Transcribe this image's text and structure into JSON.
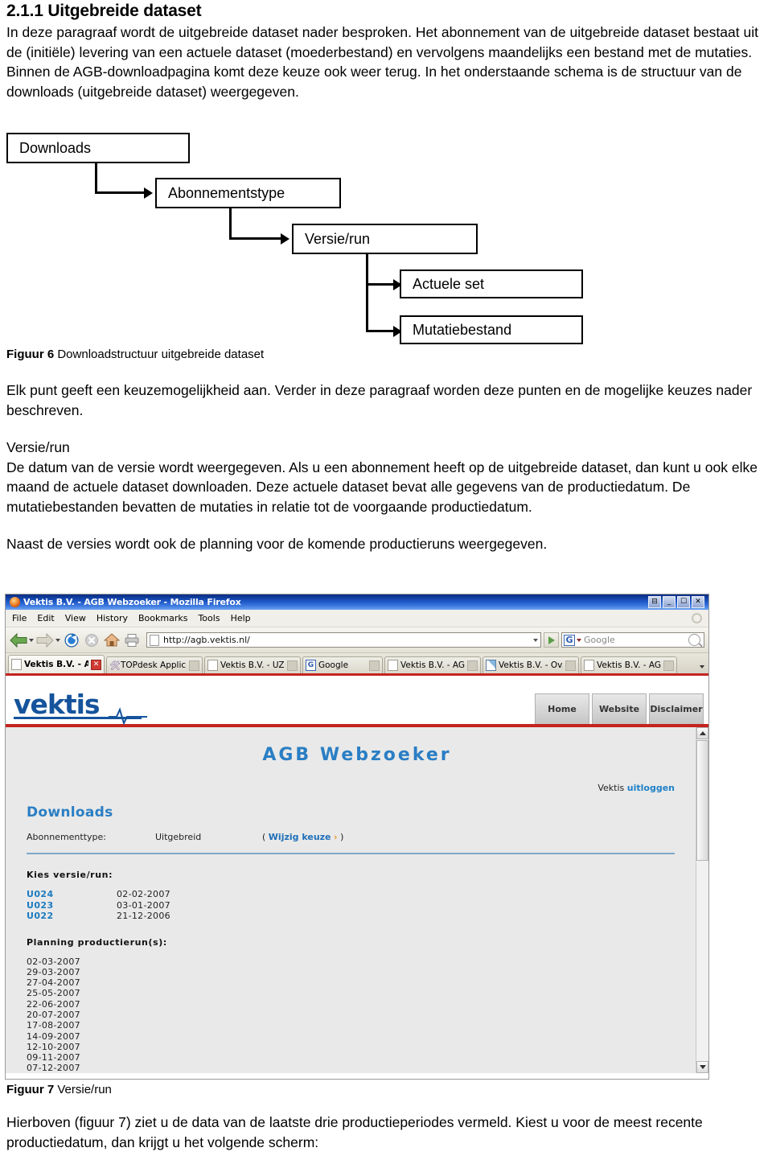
{
  "document": {
    "heading": "2.1.1 Uitgebreide dataset",
    "intro_paragraph": "In deze paragraaf wordt de uitgebreide dataset nader besproken. Het abonnement van de uitgebreide dataset bestaat uit de (initiële) levering van een actuele dataset (moederbestand) en vervolgens maandelijks een bestand met de mutaties. Binnen de AGB-downloadpagina komt deze keuze ook weer terug. In het onderstaande schema is de structuur van de downloads (uitgebreide dataset) weergegeven.",
    "after_diagram_paragraph": "Elk punt geeft een keuzemogelijkheid aan. Verder in deze paragraaf worden deze punten en de mogelijke keuzes nader beschreven.",
    "versie_run_heading": "Versie/run",
    "versie_run_paragraph": "De datum van de versie wordt weergegeven. Als u een abonnement heeft op de uitgebreide dataset, dan kunt u ook elke maand de actuele dataset downloaden. Deze actuele dataset bevat alle gegevens van de productiedatum. De mutatiebestanden bevatten de mutaties in relatie tot de voorgaande productiedatum.",
    "planning_paragraph": "Naast de versies wordt ook de planning voor de komende productieruns weergegeven.",
    "closing_paragraph": "Hierboven (figuur 7) ziet u de data van de laatste drie productieperiodes vermeld. Kiest u voor de meest recente productiedatum, dan krijgt u het volgende scherm:"
  },
  "figure6": {
    "caption_label": "Figuur 6",
    "caption_text": "Downloadstructuur uitgebreide dataset",
    "boxes": [
      {
        "label": "Downloads"
      },
      {
        "label": "Abonnementstype"
      },
      {
        "label": "Versie/run"
      },
      {
        "label": "Actuele set"
      },
      {
        "label": "Mutatiebestand"
      }
    ]
  },
  "figure7": {
    "caption_label": "Figuur 7",
    "caption_text": "Versie/run"
  },
  "browser": {
    "window_title": "Vektis B.V. - AGB Webzoeker - Mozilla Firefox",
    "window_buttons": [
      "❐",
      "–",
      "❐",
      "✕"
    ],
    "menu": [
      "File",
      "Edit",
      "View",
      "History",
      "Bookmarks",
      "Tools",
      "Help"
    ],
    "url": "http://agb.vektis.nl/",
    "search_placeholder": "Google",
    "tabs": [
      {
        "label": "Vektis B.V. - A...",
        "icon": "page-icon",
        "active": true
      },
      {
        "label": "TOPdesk Applic...",
        "icon": "topdesk-icon",
        "active": false
      },
      {
        "label": "Vektis B.V. - UZ...",
        "icon": "page-icon",
        "active": false
      },
      {
        "label": "Google",
        "icon": "google-icon",
        "active": false
      },
      {
        "label": "Vektis B.V. - AG...",
        "icon": "page-icon",
        "active": false
      },
      {
        "label": "Vektis B.V. - Ov...",
        "icon": "chart-icon",
        "active": false
      },
      {
        "label": "Vektis B.V. - AG...",
        "icon": "page-icon",
        "active": false
      }
    ]
  },
  "webpage": {
    "logo": "vektis",
    "nav": [
      "Home",
      "Website",
      "Disclaimer"
    ],
    "page_title": "AGB Webzoeker",
    "logout_prefix": "Vektis",
    "logout_link": "uitloggen",
    "section_title": "Downloads",
    "abonnement": {
      "label": "Abonnementtype:",
      "value": "Uitgebreid",
      "change_open": "(",
      "change_label": "Wijzig keuze",
      "change_chevron": "›",
      "change_close": ")"
    },
    "kies_versie_heading": "Kies versie/run:",
    "versions": [
      {
        "code": "U024",
        "date": "02-02-2007"
      },
      {
        "code": "U023",
        "date": "03-01-2007"
      },
      {
        "code": "U022",
        "date": "21-12-2006"
      }
    ],
    "planning_heading": "Planning productierun(s):",
    "planning_dates": [
      "02-03-2007",
      "29-03-2007",
      "27-04-2007",
      "25-05-2007",
      "22-06-2007",
      "20-07-2007",
      "17-08-2007",
      "14-09-2007",
      "12-10-2007",
      "09-11-2007",
      "07-12-2007"
    ]
  },
  "colors": {
    "brand_blue": "#15549c",
    "accent_red": "#c4241f",
    "title_blue": "#2a7ec4",
    "link_blue": "#1e80c8"
  }
}
